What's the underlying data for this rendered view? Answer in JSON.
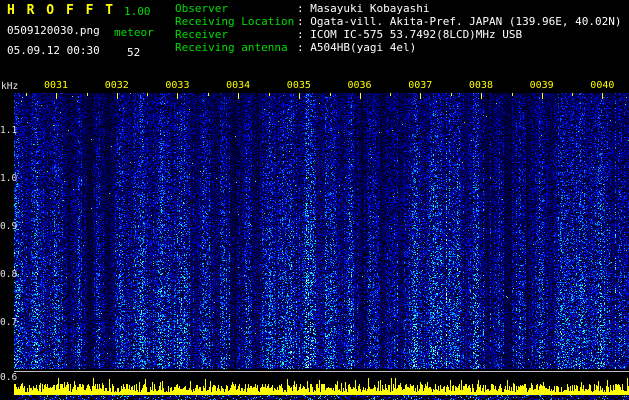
{
  "header": {
    "app_title": "H R O F F T",
    "version": "1.00",
    "filename": "0509120030.png",
    "mode_label": "meteor",
    "datetime": "05.09.12 00:30",
    "count": "52",
    "info": [
      {
        "label": "Observer",
        "value": ": Masayuki Kobayashi"
      },
      {
        "label": "Receiving Location",
        "value": ": Ogata-vill. Akita-Pref. JAPAN (139.96E, 40.02N)"
      },
      {
        "label": "Receiver",
        "value": ": ICOM IC-575 53.7492(8LCD)MHz USB"
      },
      {
        "label": "Receiving antenna",
        "value": ": A504HB(yagi 4el)"
      }
    ]
  },
  "colors": {
    "background": "#000000",
    "title_yellow": "#ffff00",
    "label_green": "#00dd00",
    "value_white": "#ffffff",
    "time_axis_yellow": "#ffff00",
    "freq_axis_white": "#e0e0e0",
    "baseline_line_gray": "#c0c0c0",
    "noise_palette": [
      "#000018",
      "#0000a0",
      "#0000ff",
      "#00ffff",
      "#60ff80",
      "#ffff60"
    ],
    "level_trace_yellow": "#ffff00"
  },
  "chart_data": {
    "type": "heatmap",
    "title": "",
    "xlabel": "",
    "ylabel": "",
    "y_unit_label": "kHz",
    "x_tick_labels": [
      "0031",
      "0032",
      "0033",
      "0034",
      "0035",
      "0036",
      "0037",
      "0038",
      "0039",
      "0040"
    ],
    "y_tick_labels": [
      "1.1",
      "1.0",
      "0.9",
      "0.8",
      "0.7",
      "0.6"
    ],
    "y_range_khz": [
      0.6,
      1.15
    ],
    "x_span_minutes": 10,
    "grid": "off",
    "legend": "none",
    "content": "10-minute radio meteor spectrogram: broadband blue/cyan noise with column-coherent vertical streaks and sparse bright green specks; horizontal white reference line at 0.6 kHz; dense yellow signal-level spike trace along the bottom over a thin blue noise strip"
  }
}
